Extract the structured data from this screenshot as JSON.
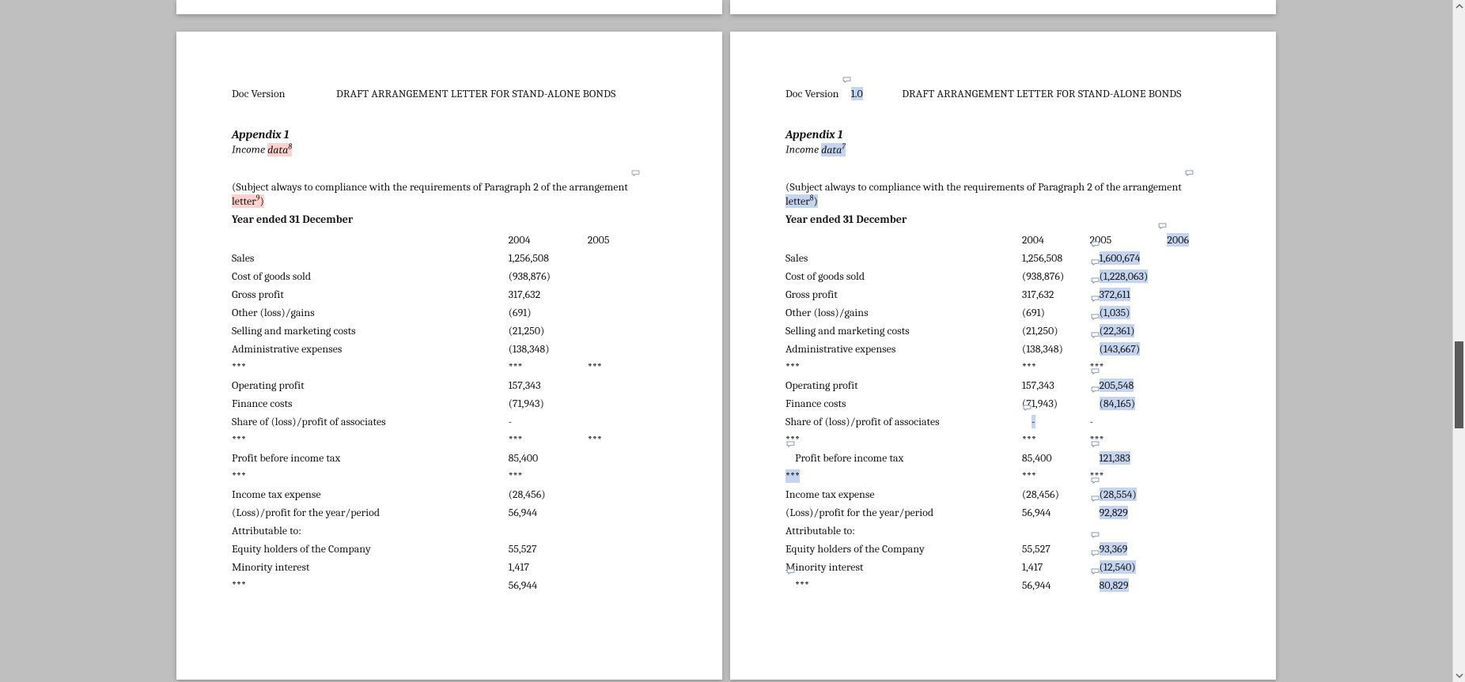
{
  "header": {
    "doc_version_label": "Doc Version",
    "title": "DRAFT ARRANGEMENT LETTER FOR STAND-ALONE BONDS",
    "version_right": "1.0"
  },
  "appendix_label": "Appendix 1",
  "subtitle_prefix": "Income ",
  "subtitle_word": "data",
  "super_left": "8",
  "super_right": "7",
  "compliance_prefix": "(Subject always to compliance with the requirements of Paragraph 2 of the arrangement ",
  "compliance_word": "letter",
  "compliance_sup_left": "9",
  "compliance_sup_right": "8",
  "compliance_close": ")",
  "yearline": "Year ended 31 December",
  "col_headers": {
    "a": "2004",
    "b": "2005",
    "c": "2006"
  },
  "rows": [
    {
      "label": "Sales",
      "a": "1,256,508",
      "b": "",
      "b2": "1,600,674"
    },
    {
      "label": "Cost of goods sold",
      "a": "(938,876)",
      "b": "",
      "b2": "(1,228,063)"
    },
    {
      "label": "Gross profit",
      "a": "317,632",
      "b": "",
      "b2": "372,611"
    },
    {
      "label": "Other (loss)/gains",
      "a": "(691)",
      "b": "",
      "b2": "(1,035)"
    },
    {
      "label": "Selling and marketing costs",
      "a": "(21,250)",
      "b": "",
      "b2": "(22,361)"
    },
    {
      "label": "Administrative expenses",
      "a": "(138,348)",
      "b": "",
      "b2": "(143,667)"
    },
    {
      "label": "***",
      "a": "***",
      "b": "***",
      "b2": "***",
      "nobhl": true
    },
    {
      "label": "Operating profit",
      "a": "157,343",
      "b": "",
      "b2": "205,548"
    },
    {
      "label": "Finance costs",
      "a": "(71,943)",
      "b": "",
      "b2": "(84,165)"
    },
    {
      "label": "Share of (loss)/profit of associates",
      "a": "-",
      "b": "",
      "ahl": true,
      "b2": "-",
      "nobhl": true
    },
    {
      "label": "***",
      "a": "***",
      "b": "***",
      "b2": "***",
      "nobhl": true
    },
    {
      "label": "Profit before income tax",
      "a": "85,400",
      "b": "",
      "b2": "121,383",
      "lblmark": true
    },
    {
      "label": "***",
      "a": "***",
      "b": "",
      "lblhl": true,
      "b2": "***",
      "nobhl": true
    },
    {
      "label": "Income tax expense",
      "a": "(28,456)",
      "b": "",
      "b2": "(28,554)"
    },
    {
      "label": "(Loss)/profit for the year/period",
      "a": "56,944",
      "b": "",
      "b2": "92,829"
    },
    {
      "label": "Attributable to:",
      "a": "",
      "b": "",
      "b2": ""
    },
    {
      "label": "Equity holders of the Company",
      "a": "55,527",
      "b": "",
      "b2": "93,369"
    },
    {
      "label": "Minority interest",
      "a": "1,417",
      "b": "",
      "b2": "(12,540)"
    },
    {
      "label": "***",
      "a": "56,944",
      "b": "",
      "lblmark": true,
      "b2": "80,829"
    }
  ]
}
